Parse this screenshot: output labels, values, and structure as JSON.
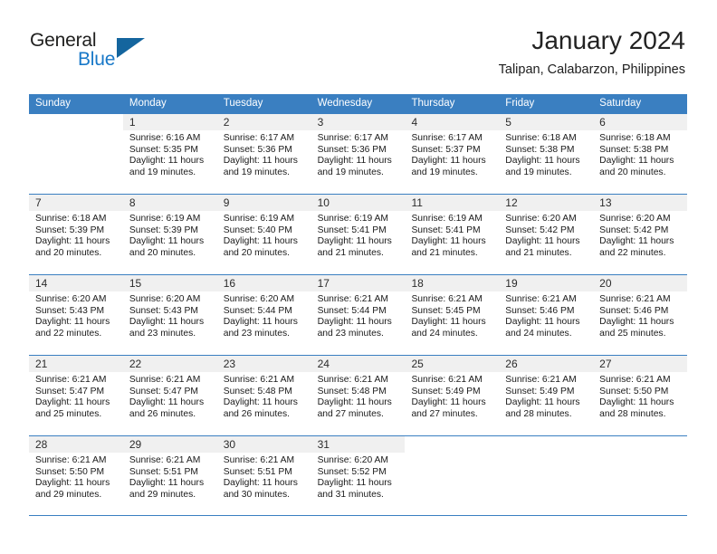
{
  "brand": {
    "name_part1": "General",
    "name_part2": "Blue",
    "color_dark": "#20201f",
    "color_blue": "#1878c8",
    "triangle_color": "#14659e"
  },
  "header": {
    "title": "January 2024",
    "location": "Talipan, Calabarzon, Philippines"
  },
  "theme": {
    "header_row_bg": "#3a7fc1",
    "day_band_bg": "#f0f0f0",
    "grid_line": "#3a7fc1"
  },
  "weekdays": [
    "Sunday",
    "Monday",
    "Tuesday",
    "Wednesday",
    "Thursday",
    "Friday",
    "Saturday"
  ],
  "weeks": [
    [
      {
        "day": "",
        "sunrise": "",
        "sunset": "",
        "daylight": ""
      },
      {
        "day": "1",
        "sunrise": "Sunrise: 6:16 AM",
        "sunset": "Sunset: 5:35 PM",
        "daylight": "Daylight: 11 hours and 19 minutes."
      },
      {
        "day": "2",
        "sunrise": "Sunrise: 6:17 AM",
        "sunset": "Sunset: 5:36 PM",
        "daylight": "Daylight: 11 hours and 19 minutes."
      },
      {
        "day": "3",
        "sunrise": "Sunrise: 6:17 AM",
        "sunset": "Sunset: 5:36 PM",
        "daylight": "Daylight: 11 hours and 19 minutes."
      },
      {
        "day": "4",
        "sunrise": "Sunrise: 6:17 AM",
        "sunset": "Sunset: 5:37 PM",
        "daylight": "Daylight: 11 hours and 19 minutes."
      },
      {
        "day": "5",
        "sunrise": "Sunrise: 6:18 AM",
        "sunset": "Sunset: 5:38 PM",
        "daylight": "Daylight: 11 hours and 19 minutes."
      },
      {
        "day": "6",
        "sunrise": "Sunrise: 6:18 AM",
        "sunset": "Sunset: 5:38 PM",
        "daylight": "Daylight: 11 hours and 20 minutes."
      }
    ],
    [
      {
        "day": "7",
        "sunrise": "Sunrise: 6:18 AM",
        "sunset": "Sunset: 5:39 PM",
        "daylight": "Daylight: 11 hours and 20 minutes."
      },
      {
        "day": "8",
        "sunrise": "Sunrise: 6:19 AM",
        "sunset": "Sunset: 5:39 PM",
        "daylight": "Daylight: 11 hours and 20 minutes."
      },
      {
        "day": "9",
        "sunrise": "Sunrise: 6:19 AM",
        "sunset": "Sunset: 5:40 PM",
        "daylight": "Daylight: 11 hours and 20 minutes."
      },
      {
        "day": "10",
        "sunrise": "Sunrise: 6:19 AM",
        "sunset": "Sunset: 5:41 PM",
        "daylight": "Daylight: 11 hours and 21 minutes."
      },
      {
        "day": "11",
        "sunrise": "Sunrise: 6:19 AM",
        "sunset": "Sunset: 5:41 PM",
        "daylight": "Daylight: 11 hours and 21 minutes."
      },
      {
        "day": "12",
        "sunrise": "Sunrise: 6:20 AM",
        "sunset": "Sunset: 5:42 PM",
        "daylight": "Daylight: 11 hours and 21 minutes."
      },
      {
        "day": "13",
        "sunrise": "Sunrise: 6:20 AM",
        "sunset": "Sunset: 5:42 PM",
        "daylight": "Daylight: 11 hours and 22 minutes."
      }
    ],
    [
      {
        "day": "14",
        "sunrise": "Sunrise: 6:20 AM",
        "sunset": "Sunset: 5:43 PM",
        "daylight": "Daylight: 11 hours and 22 minutes."
      },
      {
        "day": "15",
        "sunrise": "Sunrise: 6:20 AM",
        "sunset": "Sunset: 5:43 PM",
        "daylight": "Daylight: 11 hours and 23 minutes."
      },
      {
        "day": "16",
        "sunrise": "Sunrise: 6:20 AM",
        "sunset": "Sunset: 5:44 PM",
        "daylight": "Daylight: 11 hours and 23 minutes."
      },
      {
        "day": "17",
        "sunrise": "Sunrise: 6:21 AM",
        "sunset": "Sunset: 5:44 PM",
        "daylight": "Daylight: 11 hours and 23 minutes."
      },
      {
        "day": "18",
        "sunrise": "Sunrise: 6:21 AM",
        "sunset": "Sunset: 5:45 PM",
        "daylight": "Daylight: 11 hours and 24 minutes."
      },
      {
        "day": "19",
        "sunrise": "Sunrise: 6:21 AM",
        "sunset": "Sunset: 5:46 PM",
        "daylight": "Daylight: 11 hours and 24 minutes."
      },
      {
        "day": "20",
        "sunrise": "Sunrise: 6:21 AM",
        "sunset": "Sunset: 5:46 PM",
        "daylight": "Daylight: 11 hours and 25 minutes."
      }
    ],
    [
      {
        "day": "21",
        "sunrise": "Sunrise: 6:21 AM",
        "sunset": "Sunset: 5:47 PM",
        "daylight": "Daylight: 11 hours and 25 minutes."
      },
      {
        "day": "22",
        "sunrise": "Sunrise: 6:21 AM",
        "sunset": "Sunset: 5:47 PM",
        "daylight": "Daylight: 11 hours and 26 minutes."
      },
      {
        "day": "23",
        "sunrise": "Sunrise: 6:21 AM",
        "sunset": "Sunset: 5:48 PM",
        "daylight": "Daylight: 11 hours and 26 minutes."
      },
      {
        "day": "24",
        "sunrise": "Sunrise: 6:21 AM",
        "sunset": "Sunset: 5:48 PM",
        "daylight": "Daylight: 11 hours and 27 minutes."
      },
      {
        "day": "25",
        "sunrise": "Sunrise: 6:21 AM",
        "sunset": "Sunset: 5:49 PM",
        "daylight": "Daylight: 11 hours and 27 minutes."
      },
      {
        "day": "26",
        "sunrise": "Sunrise: 6:21 AM",
        "sunset": "Sunset: 5:49 PM",
        "daylight": "Daylight: 11 hours and 28 minutes."
      },
      {
        "day": "27",
        "sunrise": "Sunrise: 6:21 AM",
        "sunset": "Sunset: 5:50 PM",
        "daylight": "Daylight: 11 hours and 28 minutes."
      }
    ],
    [
      {
        "day": "28",
        "sunrise": "Sunrise: 6:21 AM",
        "sunset": "Sunset: 5:50 PM",
        "daylight": "Daylight: 11 hours and 29 minutes."
      },
      {
        "day": "29",
        "sunrise": "Sunrise: 6:21 AM",
        "sunset": "Sunset: 5:51 PM",
        "daylight": "Daylight: 11 hours and 29 minutes."
      },
      {
        "day": "30",
        "sunrise": "Sunrise: 6:21 AM",
        "sunset": "Sunset: 5:51 PM",
        "daylight": "Daylight: 11 hours and 30 minutes."
      },
      {
        "day": "31",
        "sunrise": "Sunrise: 6:20 AM",
        "sunset": "Sunset: 5:52 PM",
        "daylight": "Daylight: 11 hours and 31 minutes."
      },
      {
        "day": "",
        "sunrise": "",
        "sunset": "",
        "daylight": ""
      },
      {
        "day": "",
        "sunrise": "",
        "sunset": "",
        "daylight": ""
      },
      {
        "day": "",
        "sunrise": "",
        "sunset": "",
        "daylight": ""
      }
    ]
  ]
}
